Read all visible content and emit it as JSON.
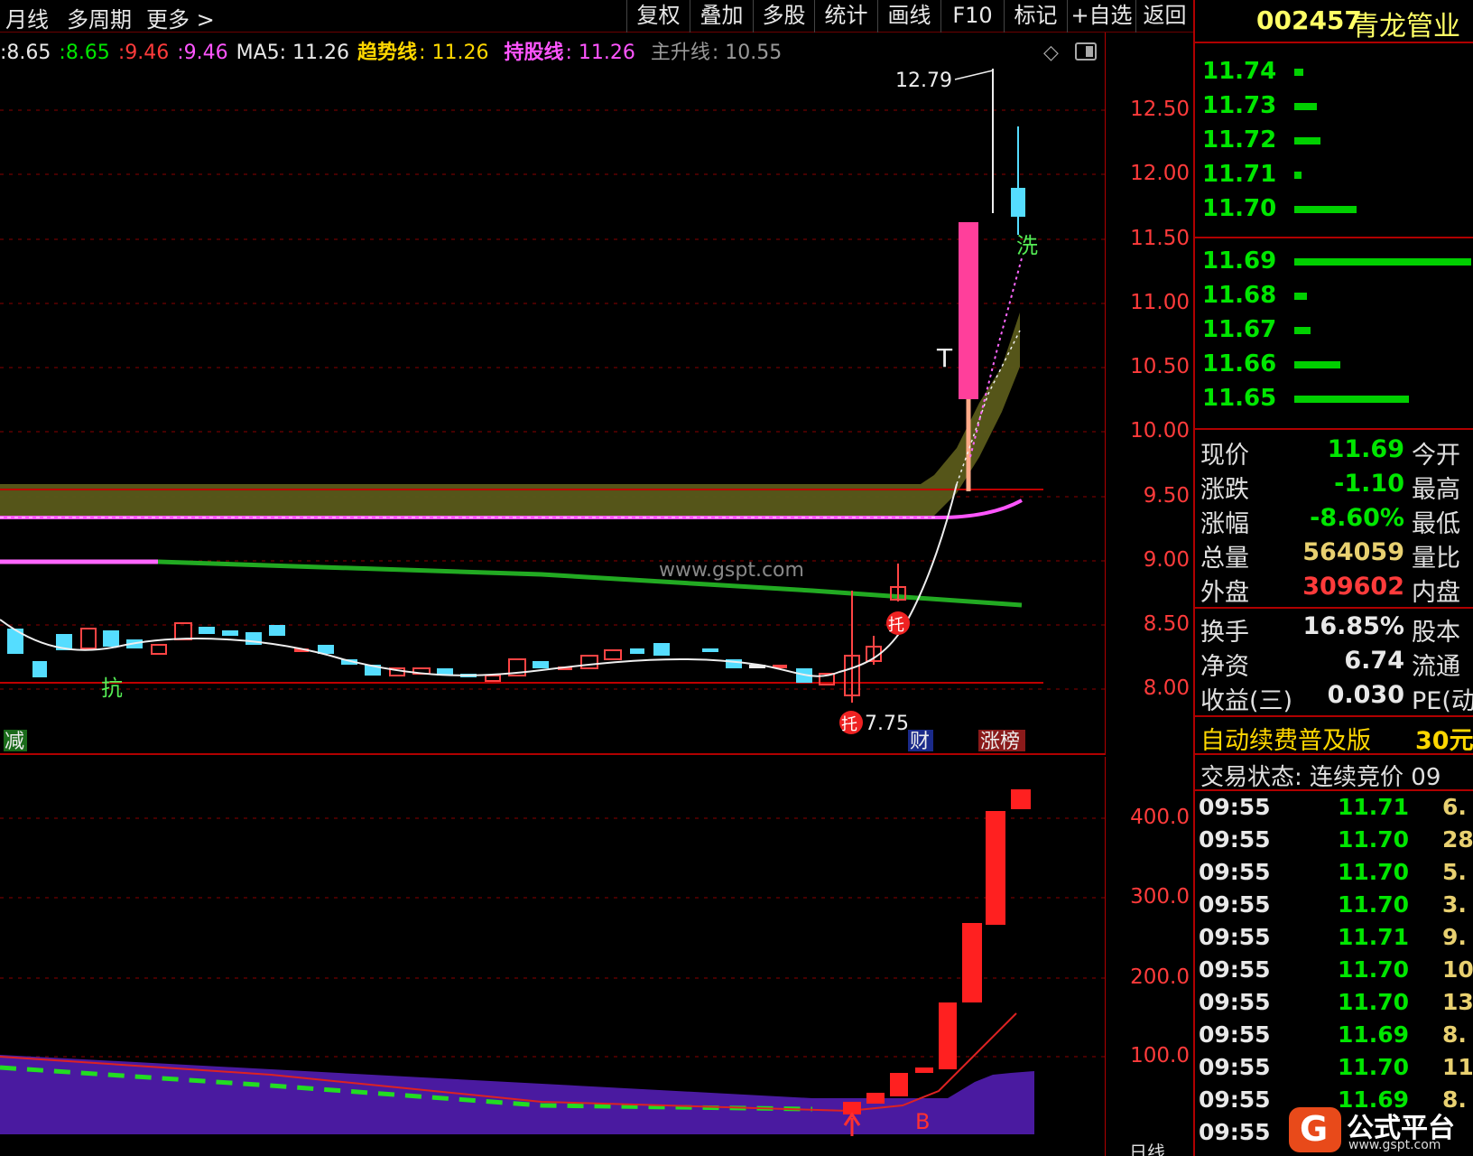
{
  "toolbar": {
    "left": [
      "月线",
      "多周期",
      "更多 >"
    ],
    "buttons": [
      "复权",
      "叠加",
      "多股",
      "统计",
      "画线",
      "F10",
      "标记",
      "+自选",
      "返回"
    ]
  },
  "indicators": {
    "v1": ":8.65",
    "v2": ":8.65",
    "v3": ":9.46",
    "v4": ":9.46",
    "ma5": "MA5: 11.26",
    "trend_label": "趋势线",
    "trend_val": ": 11.26",
    "hold_label": "持股线",
    "hold_val": ": 11.26",
    "main_label": "主升线",
    "main_val": ": 10.55"
  },
  "price_axis": [
    "12.50",
    "12.00",
    "11.50",
    "11.00",
    "10.50",
    "10.00",
    "9.50",
    "9.00",
    "8.50",
    "8.00"
  ],
  "volume_axis": [
    "400.0",
    "300.0",
    "200.0",
    "100.0"
  ],
  "annotations": {
    "high": "12.79",
    "low": "7.75",
    "wash": "洗",
    "resist": "抗",
    "support": "托",
    "reduce": "减",
    "finance": "财",
    "limit_up": "涨榜",
    "buy": "B",
    "t_mark": "T",
    "watermark": "www.gspt.com"
  },
  "stock": {
    "code": "002457",
    "name": "青龙管业"
  },
  "order_book": [
    {
      "price": "11.74",
      "bar": 0.05
    },
    {
      "price": "11.73",
      "bar": 0.13
    },
    {
      "price": "11.72",
      "bar": 0.15
    },
    {
      "price": "11.71",
      "bar": 0.04
    },
    {
      "price": "11.70",
      "bar": 0.35
    },
    {
      "price": "11.69",
      "bar": 1.0
    },
    {
      "price": "11.68",
      "bar": 0.07
    },
    {
      "price": "11.67",
      "bar": 0.09
    },
    {
      "price": "11.66",
      "bar": 0.26
    },
    {
      "price": "11.65",
      "bar": 0.65
    }
  ],
  "quote": [
    {
      "label": "现价",
      "value": "11.69",
      "color": "#00e600",
      "label2": "今开"
    },
    {
      "label": "涨跌",
      "value": "-1.10",
      "color": "#00e600",
      "label2": "最高"
    },
    {
      "label": "涨幅",
      "value": "-8.60%",
      "color": "#00e600",
      "label2": "最低"
    },
    {
      "label": "总量",
      "value": "564059",
      "color": "#e8d070",
      "label2": "量比"
    },
    {
      "label": "外盘",
      "value": "309602",
      "color": "#ff3b3b",
      "label2": "内盘"
    },
    {
      "label": "换手",
      "value": "16.85%",
      "color": "#e8e8e8",
      "label2": "股本"
    },
    {
      "label": "净资",
      "value": "6.74",
      "color": "#e8e8e8",
      "label2": "流通"
    },
    {
      "label": "收益(三)",
      "value": "0.030",
      "color": "#e8e8e8",
      "label2": "PE(动"
    }
  ],
  "promo": {
    "text": "自动续费普及版",
    "price": "30元"
  },
  "status": {
    "text": "交易状态: 连续竞价 09"
  },
  "trades": [
    {
      "time": "09:55",
      "price": "11.71",
      "vol": "6."
    },
    {
      "time": "09:55",
      "price": "11.70",
      "vol": "28."
    },
    {
      "time": "09:55",
      "price": "11.70",
      "vol": "5."
    },
    {
      "time": "09:55",
      "price": "11.70",
      "vol": "3."
    },
    {
      "time": "09:55",
      "price": "11.71",
      "vol": "9."
    },
    {
      "time": "09:55",
      "price": "11.70",
      "vol": "10."
    },
    {
      "time": "09:55",
      "price": "11.70",
      "vol": "13."
    },
    {
      "time": "09:55",
      "price": "11.69",
      "vol": "8."
    },
    {
      "time": "09:55",
      "price": "11.70",
      "vol": "11."
    },
    {
      "time": "09:55",
      "price": "11.69",
      "vol": "8."
    },
    {
      "time": "09:55",
      "price": "",
      "vol": ""
    }
  ],
  "logo": {
    "text": "公式平台",
    "url": "www.gspt.com"
  },
  "bottom": {
    "label": "日线"
  }
}
